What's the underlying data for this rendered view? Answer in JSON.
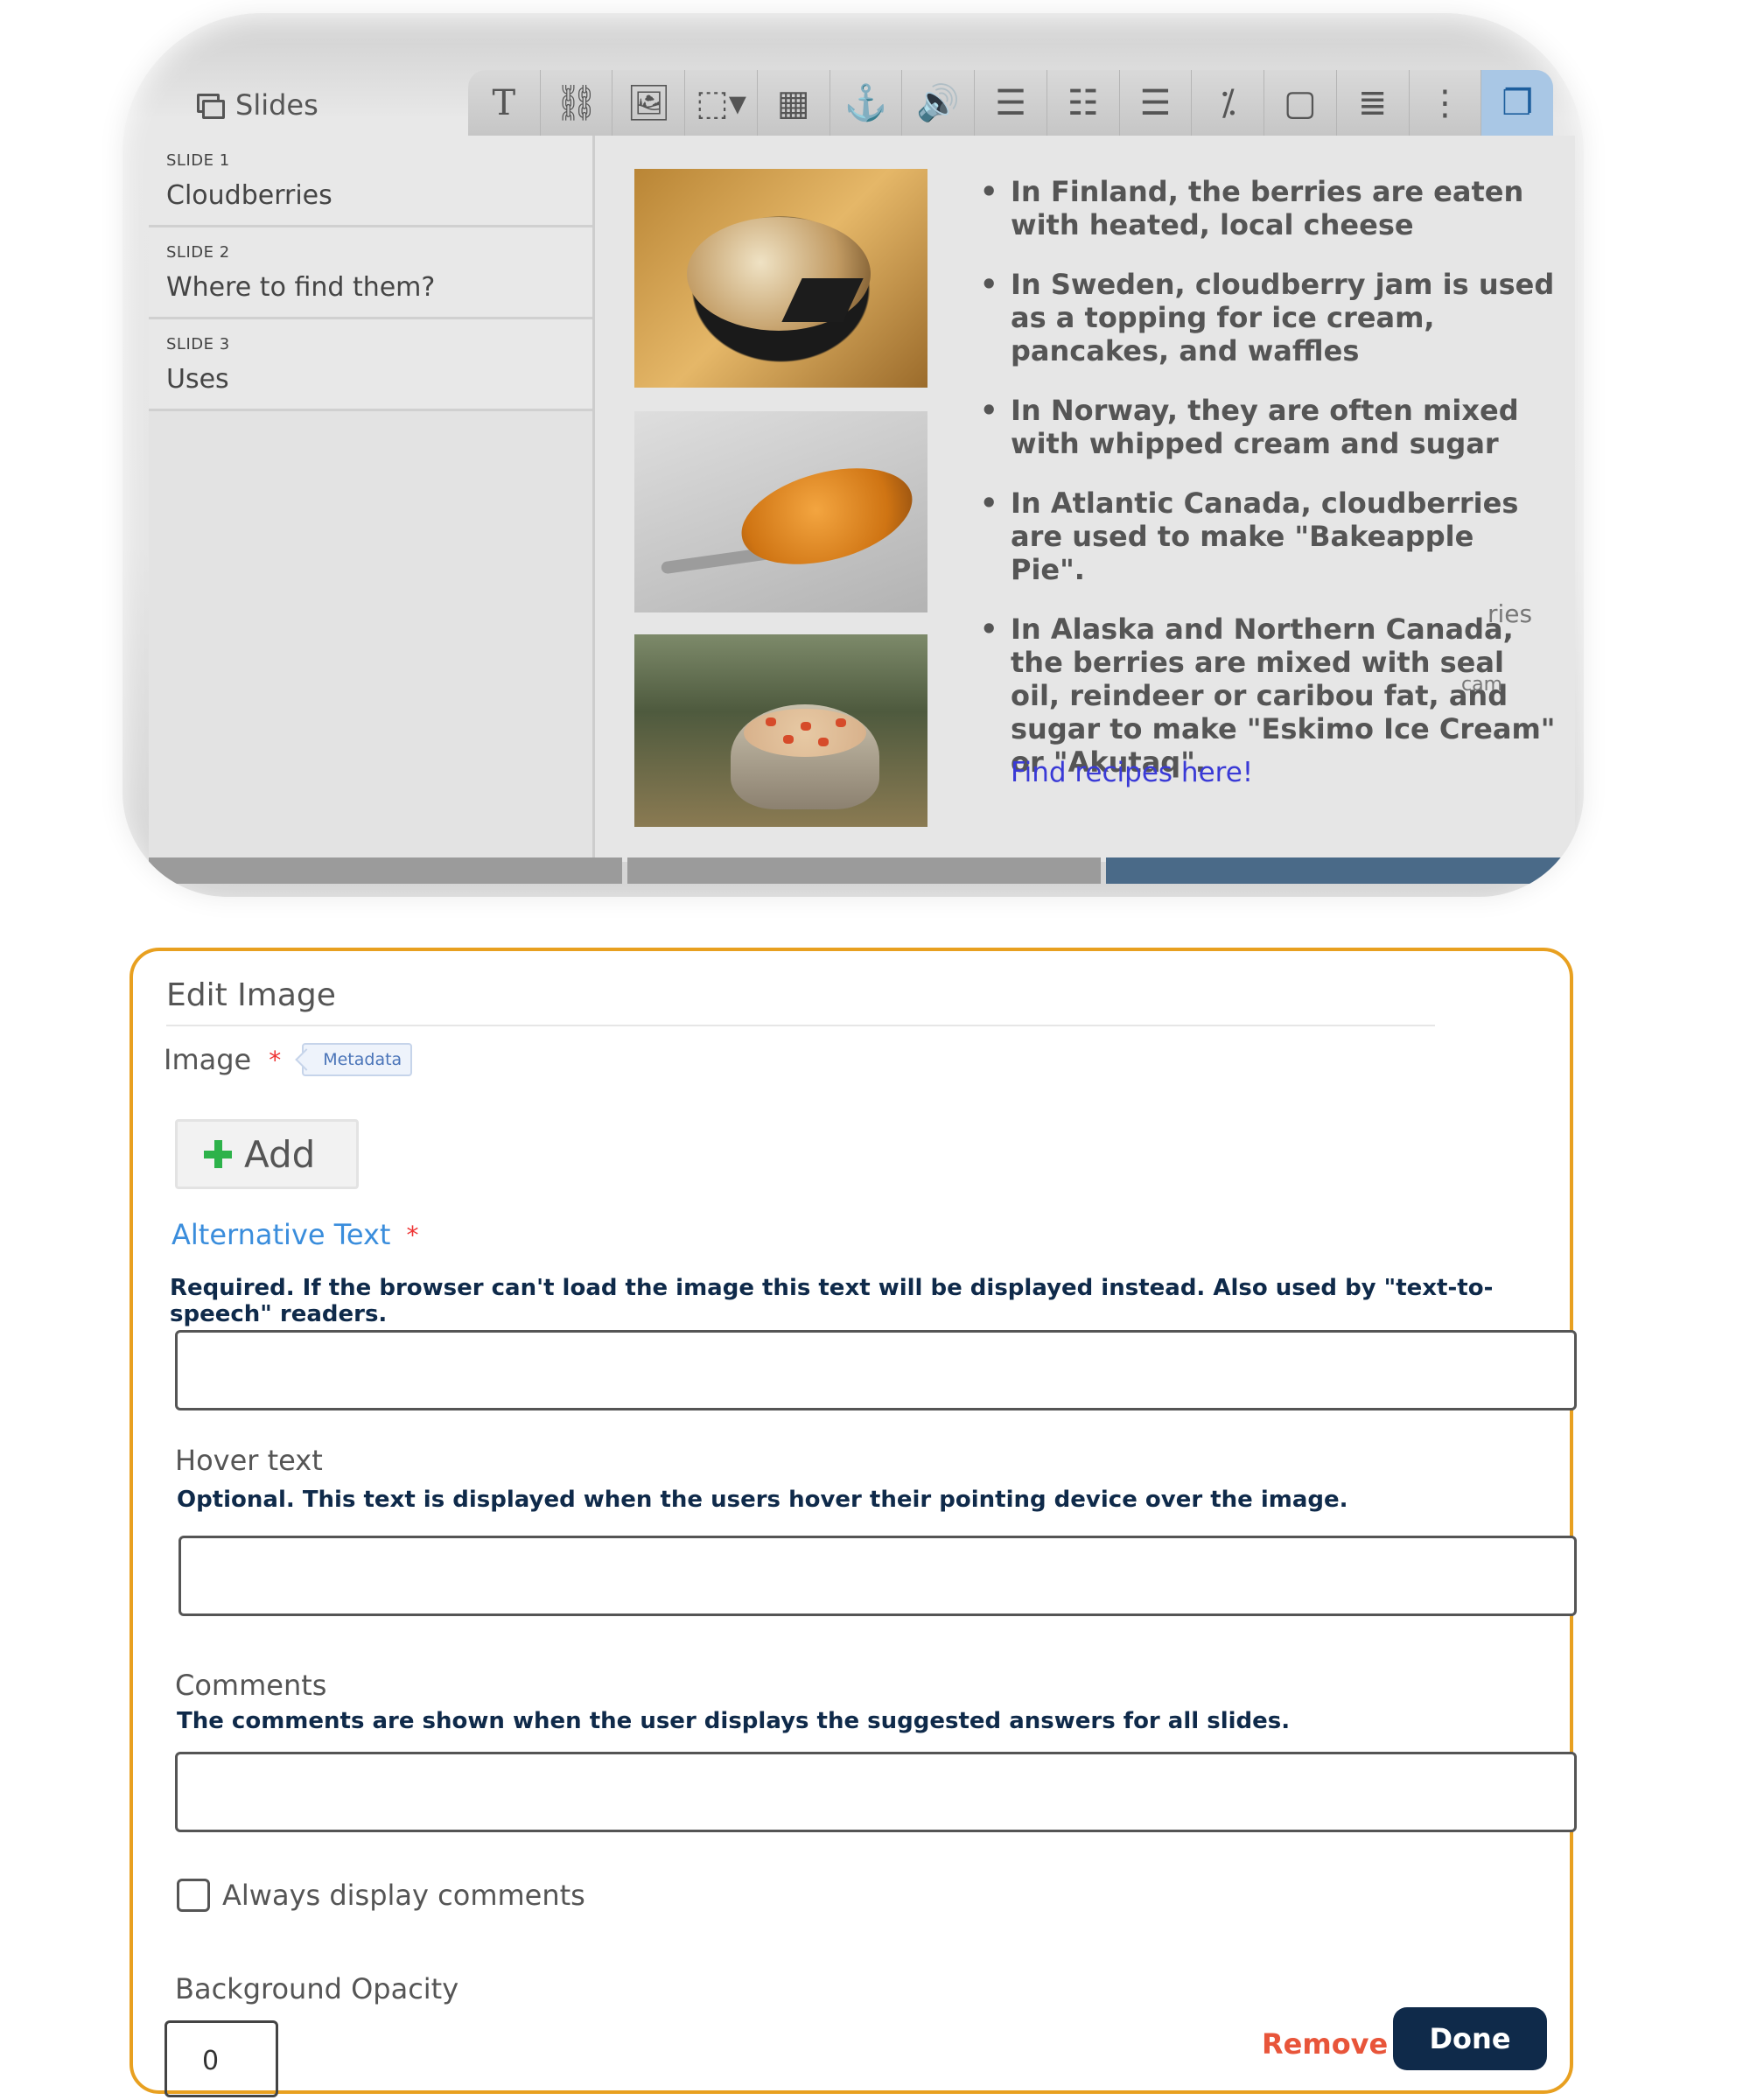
{
  "slides_panel": {
    "title": "Slides"
  },
  "toolbar": {
    "tools": [
      {
        "name": "text-tool",
        "glyph": "T"
      },
      {
        "name": "link-tool",
        "glyph": "⛓"
      },
      {
        "name": "image-tool",
        "glyph": "🖼"
      },
      {
        "name": "shape-tool",
        "glyph": "⬚▾"
      },
      {
        "name": "video-tool",
        "glyph": "▦"
      },
      {
        "name": "anchor-tool",
        "glyph": "⚓"
      },
      {
        "name": "audio-tool",
        "glyph": "🔊"
      },
      {
        "name": "fill-blanks-tool",
        "glyph": "☰"
      },
      {
        "name": "multiple-choice-tool",
        "glyph": "☷"
      },
      {
        "name": "checklist-tool",
        "glyph": "☰"
      },
      {
        "name": "percent-tool",
        "glyph": "⁒"
      },
      {
        "name": "dialog-tool",
        "glyph": "▢"
      },
      {
        "name": "list-tool",
        "glyph": "≣"
      },
      {
        "name": "more-tool",
        "glyph": "⋮"
      },
      {
        "name": "paste-tool",
        "glyph": "❐"
      }
    ]
  },
  "slides": [
    {
      "num": "SLIDE 1",
      "title": "Cloudberries"
    },
    {
      "num": "SLIDE 2",
      "title": "Where to find them?"
    },
    {
      "num": "SLIDE 3",
      "title": "Uses"
    }
  ],
  "content": {
    "bullets": [
      "In Finland, the berries are eaten with heated, local cheese",
      "In Sweden, cloudberry jam is used as a topping for ice cream, pancakes, and waffles",
      "In Norway, they are often mixed with whipped cream and sugar",
      "In Atlantic Canada, cloudberries are used to make \"Bakeapple Pie\".",
      "In Alaska and Northern Canada, the berries are mixed with seal oil, reindeer or caribou fat, and sugar to make \"Eskimo Ice Cream\" or \"Akutaq\"."
    ],
    "ghost_text_1": "ries",
    "ghost_text_2": "cam",
    "link": "Find recipes here!"
  },
  "edit_panel": {
    "title": "Edit Image",
    "image_label": "Image",
    "required_mark": "*",
    "metadata_tag": "Metadata",
    "add_label": "Add",
    "alt_label": "Alternative Text",
    "alt_help": "Required. If the browser can't load the image this text will be displayed instead. Also used by \"text-to-speech\" readers.",
    "alt_value": "",
    "hover_label": "Hover text",
    "hover_help": "Optional. This text is displayed when the users hover their pointing device over the image.",
    "hover_value": "",
    "comments_label": "Comments",
    "comments_help": "The comments are shown when the user displays the suggested answers for all slides.",
    "comments_value": "",
    "always_display_label": "Always display comments",
    "always_display_checked": false,
    "opacity_label": "Background Opacity",
    "opacity_value": "0",
    "remove_label": "Remove",
    "done_label": "Done"
  },
  "colors": {
    "panel_border": "#e8a020",
    "done_bg": "#0f2a4a",
    "remove_text": "#e8553a",
    "alt_label": "#3a8ddc",
    "link": "#3a3ad6"
  }
}
